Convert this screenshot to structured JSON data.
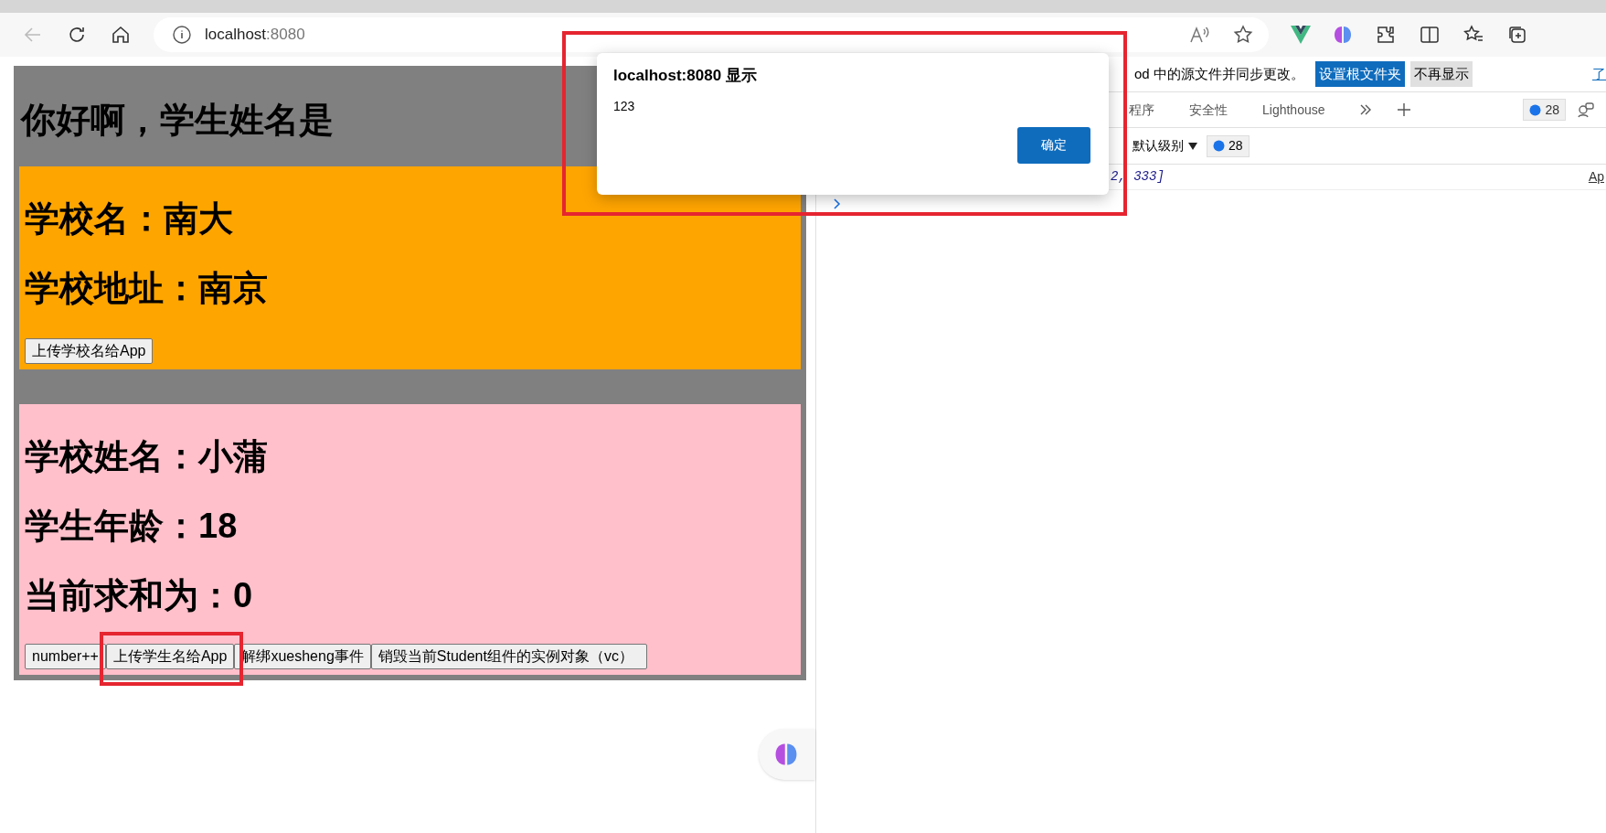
{
  "browser": {
    "address": {
      "host": "localhost",
      "port": ":8080"
    }
  },
  "page": {
    "heading": "你好啊，学生姓名是",
    "school": {
      "lines": [
        "学校名：南大",
        "学校地址：南京"
      ],
      "button": "上传学校名给App"
    },
    "student": {
      "lines": [
        "学校姓名：小蒲",
        "学生年龄：18",
        "当前求和为：0"
      ],
      "buttons": [
        {
          "label": "number++",
          "highlighted": false
        },
        {
          "label": "上传学生名给App",
          "highlighted": true
        },
        {
          "label": "解绑xuesheng事件",
          "highlighted": false
        },
        {
          "label": "销毁当前Student组件的实例对象（vc）",
          "highlighted": false
        }
      ]
    }
  },
  "devtools": {
    "infobar": {
      "message": "od 中的源文件并同步更改。",
      "buttons": [
        "设置根文件夹",
        "不再显示"
      ],
      "link": "了"
    },
    "tabs": [
      {
        "label": "程序"
      },
      {
        "label": "安全性"
      },
      {
        "label": "Lighthouse"
      }
    ],
    "issues_count": "28",
    "level_filter": "默认级别",
    "filter_count": "28",
    "console": {
      "message": "2, 333]",
      "source": "Ap"
    }
  },
  "dialog": {
    "title": "localhost:8080 显示",
    "message": "123",
    "ok": "确定",
    "highlighted": true
  }
}
